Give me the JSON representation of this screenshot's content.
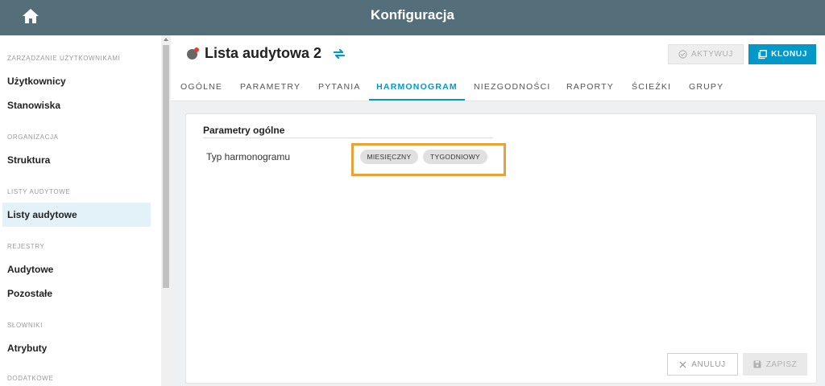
{
  "app": {
    "title": "Konfiguracja"
  },
  "sidebar": {
    "sections": [
      {
        "label": "ZARZĄDZANIE UŻYTKOWNIKAMI"
      },
      {
        "label": "ORGANIZACJA"
      },
      {
        "label": "LISTY AUDYTOWE"
      },
      {
        "label": "REJESTRY"
      },
      {
        "label": "SŁOWNIKI"
      },
      {
        "label": "DODATKOWE"
      }
    ],
    "items": [
      {
        "label": "Użytkownicy"
      },
      {
        "label": "Stanowiska"
      },
      {
        "label": "Struktura"
      },
      {
        "label": "Listy audytowe"
      },
      {
        "label": "Audytowe"
      },
      {
        "label": "Pozostałe"
      },
      {
        "label": "Atrybuty"
      }
    ],
    "active_item": "Listy audytowe"
  },
  "header": {
    "title": "Lista audytowa 2",
    "aktywuj_label": "AKTYWUJ",
    "klonuj_label": "KLONUJ"
  },
  "tabs": [
    {
      "label": "OGÓLNE"
    },
    {
      "label": "PARAMETRY"
    },
    {
      "label": "PYTANIA"
    },
    {
      "label": "HARMONOGRAM"
    },
    {
      "label": "NIEZGODNOŚCI"
    },
    {
      "label": "RAPORTY"
    },
    {
      "label": "ŚCIEŻKI"
    },
    {
      "label": "GRUPY"
    }
  ],
  "active_tab": "HARMONOGRAM",
  "card": {
    "section_title": "Parametry ogólne",
    "field_label": "Typ harmonogramu",
    "options": [
      {
        "label": "MIESIĘCZNY"
      },
      {
        "label": "TYGODNIOWY"
      }
    ],
    "anuluj_label": "ANULUJ",
    "zapisz_label": "ZAPISZ"
  },
  "colors": {
    "topbar": "#546e7a",
    "accent": "#0398c7",
    "highlight": "#e8a23a",
    "active_sidebar_bg": "#e3f2f8"
  },
  "icons": [
    "home-icon",
    "swap-arrows-icon",
    "check-circle-icon",
    "clone-icon",
    "close-icon",
    "save-icon"
  ]
}
